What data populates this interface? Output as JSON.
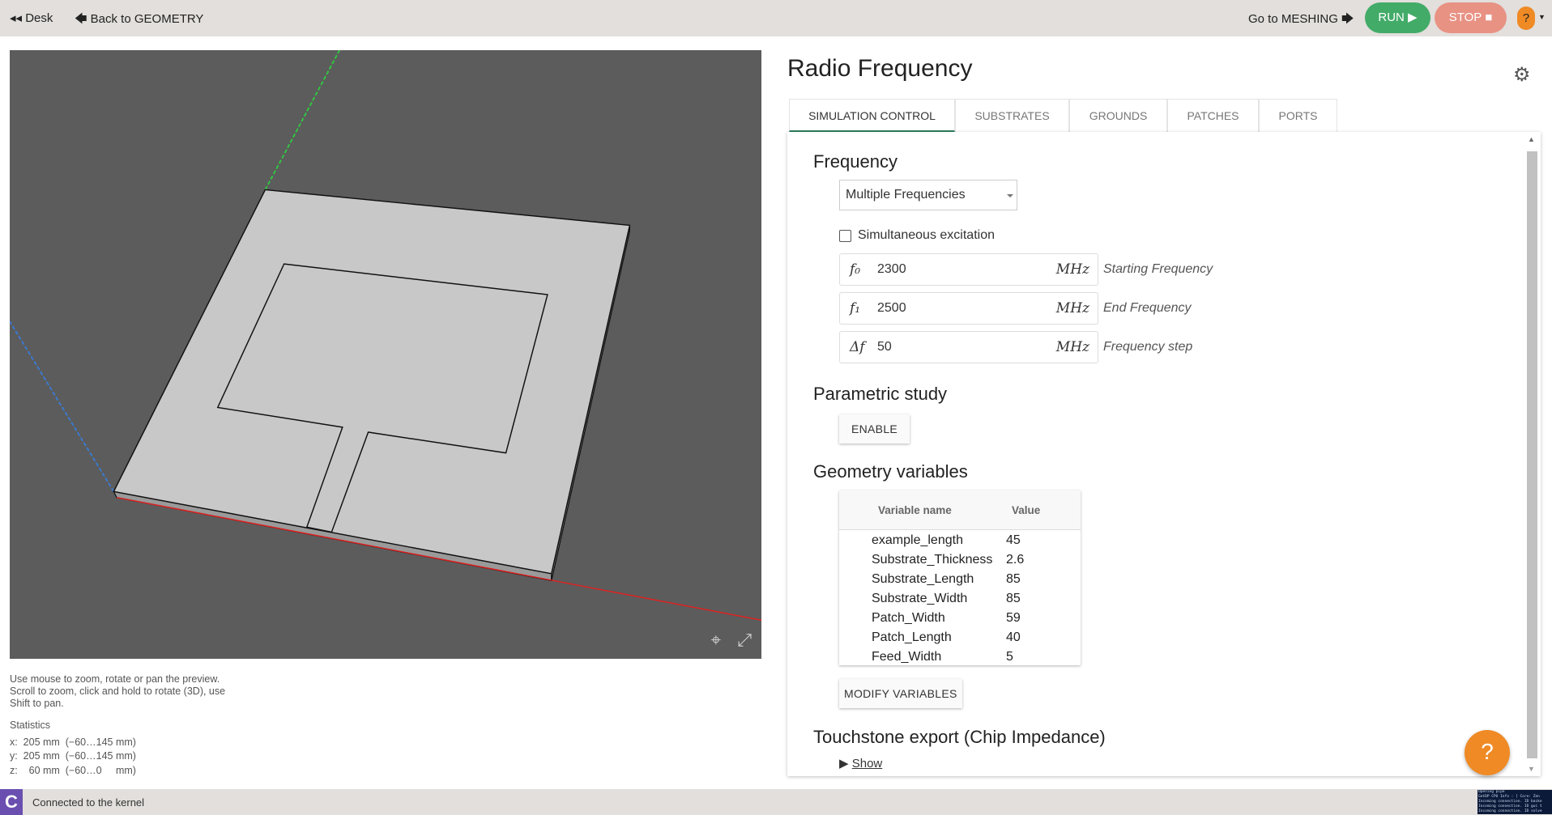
{
  "topbar": {
    "desk": "◂◂ Desk",
    "back": "🡄 Back to GEOMETRY",
    "meshing": "Go to MESHING 🡆",
    "run": "RUN ▶",
    "stop": "STOP ■",
    "help": "?"
  },
  "colors": {
    "run": "#43ab68",
    "stop": "#e89284",
    "help": "#ef8a25",
    "accent": "#2e7d5b"
  },
  "viewport": {
    "help": [
      "Use mouse to zoom, rotate or pan the preview.",
      "Scroll to zoom, click and hold to rotate (3D), use",
      "Shift to pan."
    ],
    "stats_label": "Statistics",
    "stats": [
      "x:  205 mm  (−60…145 mm)",
      "y:  205 mm  (−60…145 mm)",
      "z:    60 mm  (−60…0     mm)"
    ],
    "icons": [
      "focus-icon",
      "fullscreen-icon"
    ]
  },
  "status": {
    "text": "Connected to the kernel",
    "logo": "C",
    "terminal": [
      "Opening pipe",
      "GetDP CPU Info : [ Core: Zen",
      "Incoming connection. ID backe",
      "Incoming connection. ID gui t",
      "Incoming connection. ID solve"
    ]
  },
  "panel": {
    "title": "Radio Frequency",
    "tabs": [
      "SIMULATION CONTROL",
      "SUBSTRATES",
      "GROUNDS",
      "PATCHES",
      "PORTS"
    ],
    "active_tab": 0,
    "frequency": {
      "heading": "Frequency",
      "mode": "Multiple Frequencies",
      "simultaneous_label": "Simultaneous excitation",
      "simultaneous": false,
      "fields": [
        {
          "symbol": "f₀",
          "value": "2300",
          "unit": "MHz",
          "label": "Starting Frequency"
        },
        {
          "symbol": "f₁",
          "value": "2500",
          "unit": "MHz",
          "label": "End Frequency"
        },
        {
          "symbol": "Δf",
          "value": "50",
          "unit": "MHz",
          "label": "Frequency step"
        }
      ]
    },
    "parametric": {
      "heading": "Parametric study",
      "button": "ENABLE"
    },
    "geometry": {
      "heading": "Geometry variables",
      "columns": [
        "Variable name",
        "Value"
      ],
      "rows": [
        [
          "example_length",
          "45"
        ],
        [
          "Substrate_Thickness",
          "2.6"
        ],
        [
          "Substrate_Length",
          "85"
        ],
        [
          "Substrate_Width",
          "85"
        ],
        [
          "Patch_Width",
          "59"
        ],
        [
          "Patch_Length",
          "40"
        ],
        [
          "Feed_Width",
          "5"
        ]
      ],
      "button": "MODIFY VARIABLES"
    },
    "touchstone": {
      "heading": "Touchstone export (Chip Impedance)",
      "show": "Show"
    }
  }
}
